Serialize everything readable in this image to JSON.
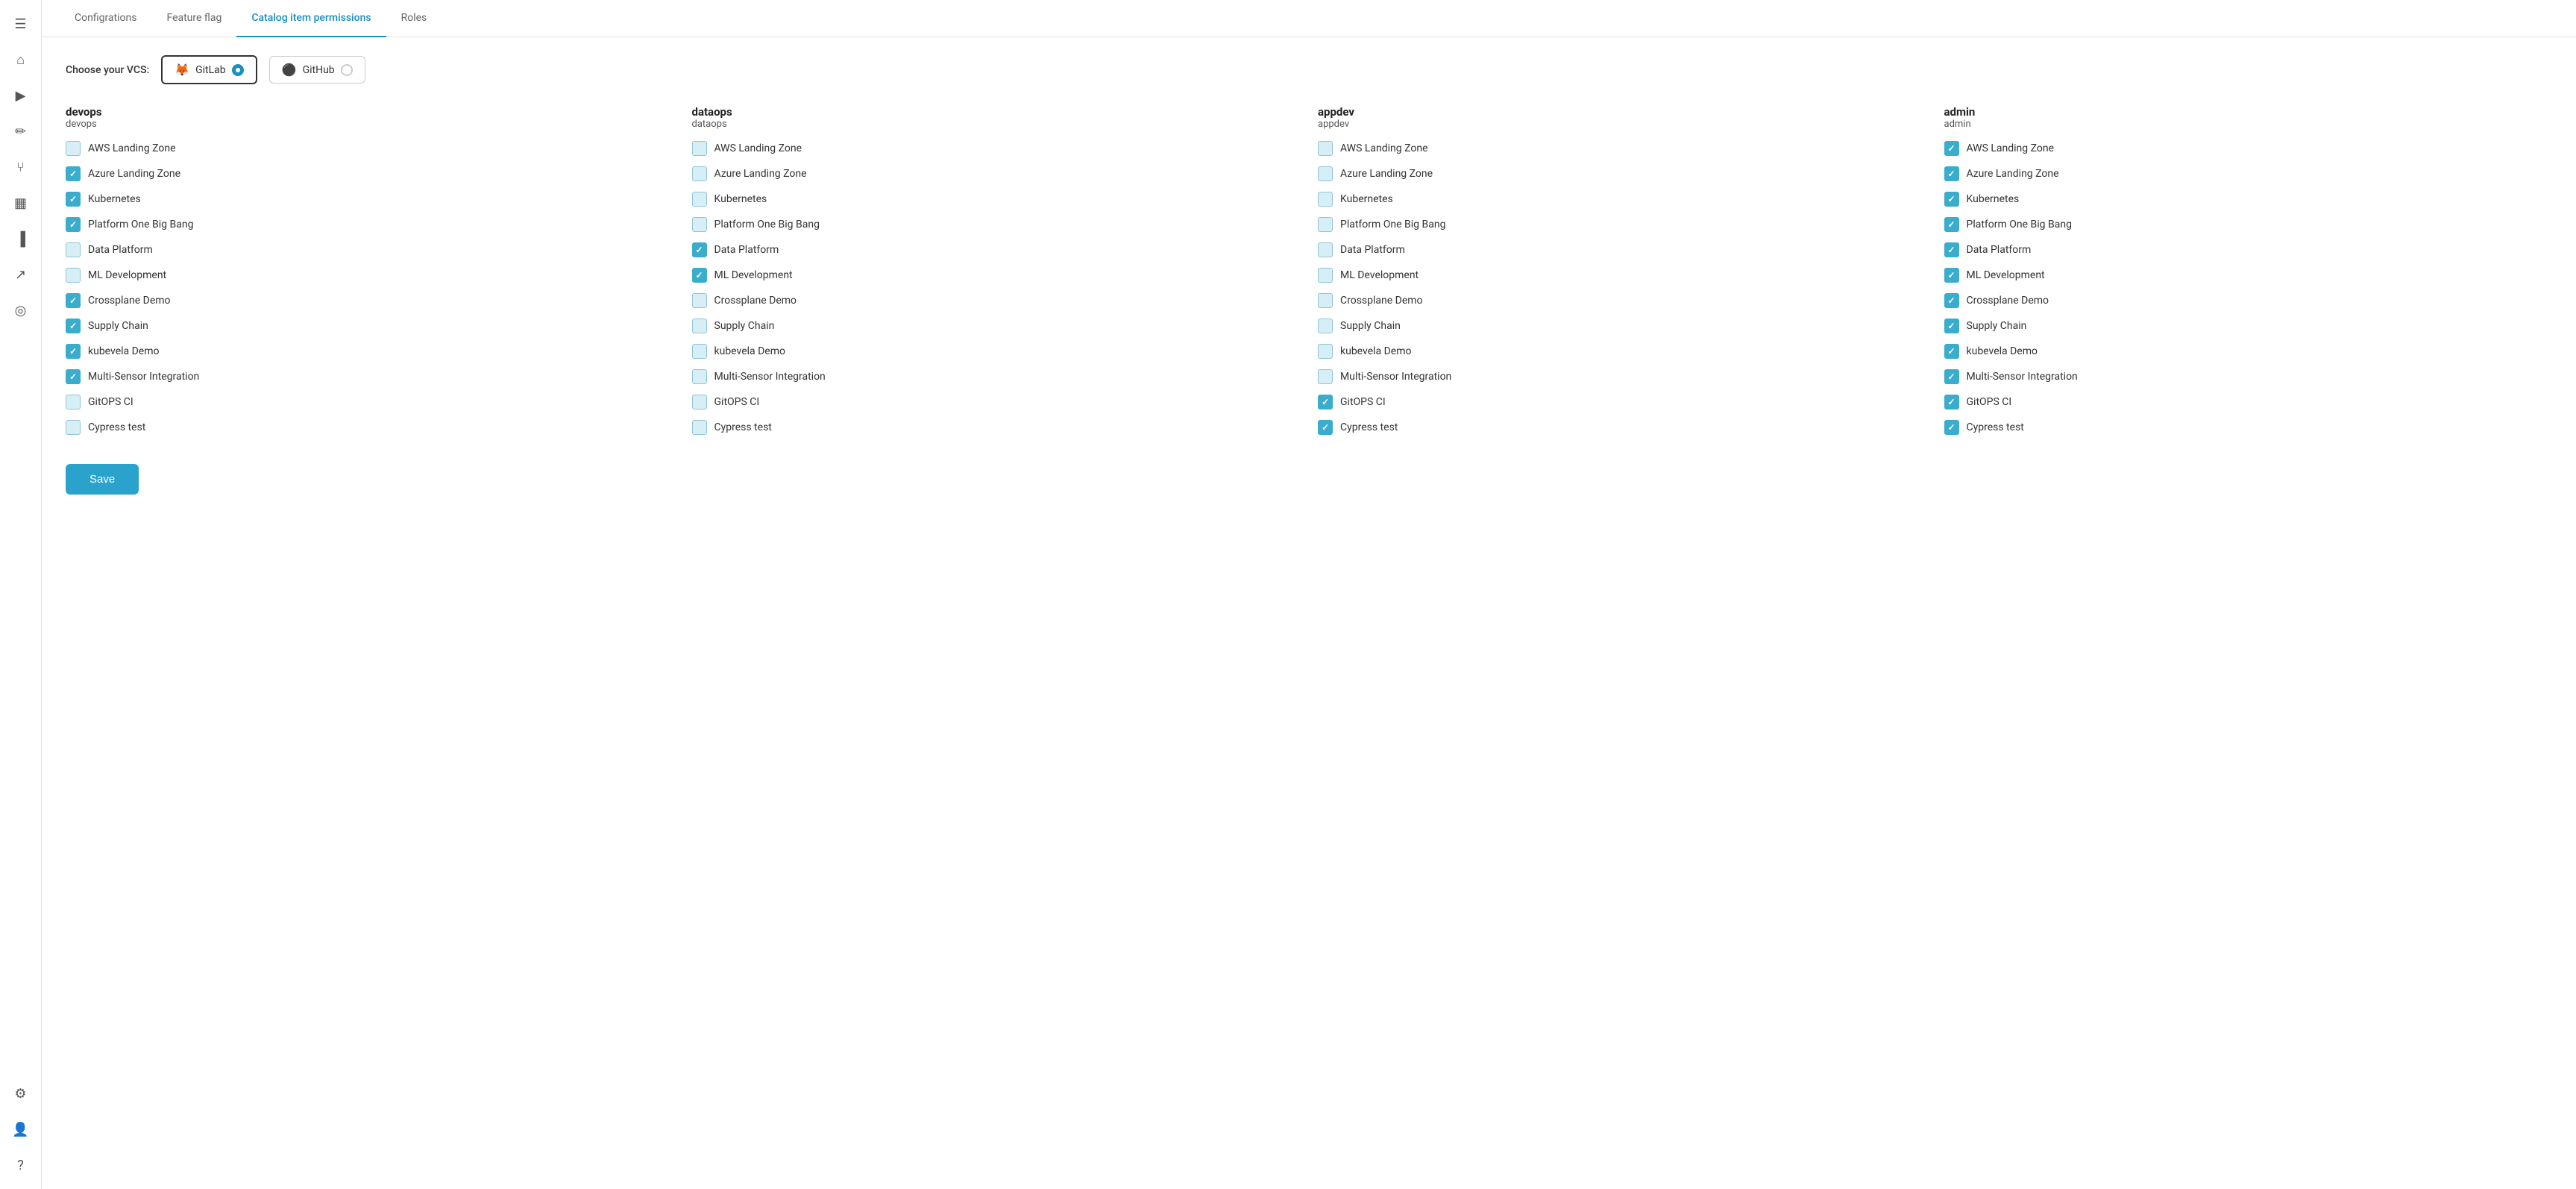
{
  "tabs": [
    {
      "id": "configurations",
      "label": "Configrations",
      "active": false
    },
    {
      "id": "feature-flag",
      "label": "Feature flag",
      "active": false
    },
    {
      "id": "catalog-item-permissions",
      "label": "Catalog item permissions",
      "active": true
    },
    {
      "id": "roles",
      "label": "Roles",
      "active": false
    }
  ],
  "vcs": {
    "label": "Choose your VCS:",
    "options": [
      {
        "id": "gitlab",
        "label": "GitLab",
        "selected": true,
        "icon": "🦊"
      },
      {
        "id": "github",
        "label": "GitHub",
        "selected": false,
        "icon": "⚫"
      }
    ]
  },
  "groups": [
    {
      "id": "devops",
      "name": "devops",
      "subname": "devops",
      "items": [
        {
          "label": "AWS Landing Zone",
          "checked": false
        },
        {
          "label": "Azure Landing Zone",
          "checked": true
        },
        {
          "label": "Kubernetes",
          "checked": true
        },
        {
          "label": "Platform One Big Bang",
          "checked": true
        },
        {
          "label": "Data Platform",
          "checked": false
        },
        {
          "label": "ML Development",
          "checked": false
        },
        {
          "label": "Crossplane Demo",
          "checked": true
        },
        {
          "label": "Supply Chain",
          "checked": true
        },
        {
          "label": "kubevela Demo",
          "checked": true
        },
        {
          "label": "Multi-Sensor Integration",
          "checked": true
        },
        {
          "label": "GitOPS CI",
          "checked": false
        },
        {
          "label": "Cypress test",
          "checked": false
        }
      ]
    },
    {
      "id": "dataops",
      "name": "dataops",
      "subname": "dataops",
      "items": [
        {
          "label": "AWS Landing Zone",
          "checked": false
        },
        {
          "label": "Azure Landing Zone",
          "checked": false
        },
        {
          "label": "Kubernetes",
          "checked": false
        },
        {
          "label": "Platform One Big Bang",
          "checked": false
        },
        {
          "label": "Data Platform",
          "checked": true
        },
        {
          "label": "ML Development",
          "checked": true
        },
        {
          "label": "Crossplane Demo",
          "checked": false
        },
        {
          "label": "Supply Chain",
          "checked": false
        },
        {
          "label": "kubevela Demo",
          "checked": false
        },
        {
          "label": "Multi-Sensor Integration",
          "checked": false
        },
        {
          "label": "GitOPS CI",
          "checked": false
        },
        {
          "label": "Cypress test",
          "checked": false
        }
      ]
    },
    {
      "id": "appdev",
      "name": "appdev",
      "subname": "appdev",
      "items": [
        {
          "label": "AWS Landing Zone",
          "checked": false
        },
        {
          "label": "Azure Landing Zone",
          "checked": false
        },
        {
          "label": "Kubernetes",
          "checked": false
        },
        {
          "label": "Platform One Big Bang",
          "checked": false
        },
        {
          "label": "Data Platform",
          "checked": false
        },
        {
          "label": "ML Development",
          "checked": false
        },
        {
          "label": "Crossplane Demo",
          "checked": false
        },
        {
          "label": "Supply Chain",
          "checked": false
        },
        {
          "label": "kubevela Demo",
          "checked": false
        },
        {
          "label": "Multi-Sensor Integration",
          "checked": false
        },
        {
          "label": "GitOPS CI",
          "checked": true
        },
        {
          "label": "Cypress test",
          "checked": true
        }
      ]
    },
    {
      "id": "admin",
      "name": "admin",
      "subname": "admin",
      "items": [
        {
          "label": "AWS Landing Zone",
          "checked": true
        },
        {
          "label": "Azure Landing Zone",
          "checked": true
        },
        {
          "label": "Kubernetes",
          "checked": true
        },
        {
          "label": "Platform One Big Bang",
          "checked": true
        },
        {
          "label": "Data Platform",
          "checked": true
        },
        {
          "label": "ML Development",
          "checked": true
        },
        {
          "label": "Crossplane Demo",
          "checked": true
        },
        {
          "label": "Supply Chain",
          "checked": true
        },
        {
          "label": "kubevela Demo",
          "checked": true
        },
        {
          "label": "Multi-Sensor Integration",
          "checked": true
        },
        {
          "label": "GitOPS CI",
          "checked": true
        },
        {
          "label": "Cypress test",
          "checked": true
        }
      ]
    }
  ],
  "sidebar": {
    "icons": [
      {
        "name": "menu-icon",
        "symbol": "☰"
      },
      {
        "name": "home-icon",
        "symbol": "⌂"
      },
      {
        "name": "play-icon",
        "symbol": "▶"
      },
      {
        "name": "edit-icon",
        "symbol": "✏"
      },
      {
        "name": "branch-icon",
        "symbol": "⑂"
      },
      {
        "name": "table-icon",
        "symbol": "▦"
      },
      {
        "name": "chart-icon",
        "symbol": "📊"
      },
      {
        "name": "trend-icon",
        "symbol": "📈"
      },
      {
        "name": "settings-circle-icon",
        "symbol": "⚙"
      },
      {
        "name": "settings-icon",
        "symbol": "⚙"
      },
      {
        "name": "user-icon",
        "symbol": "👤"
      },
      {
        "name": "question-icon",
        "symbol": "?"
      }
    ]
  },
  "save_button": "Save"
}
